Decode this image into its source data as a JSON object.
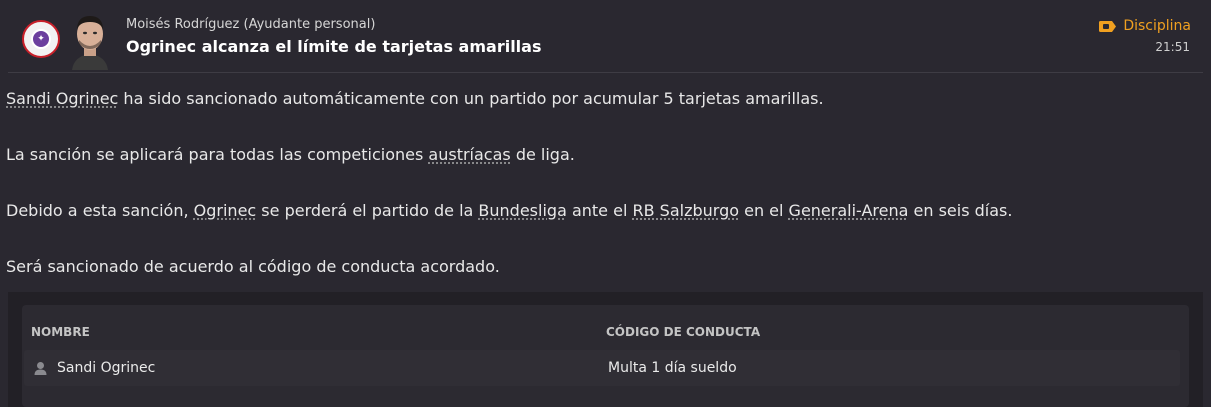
{
  "header": {
    "sender": "Moisés Rodríguez  (Ayudante personal)",
    "subject": "Ogrinec alcanza el límite de tarjetas amarillas",
    "category": "Disciplina",
    "category_icon": "yellow-card-tag-icon",
    "time": "21:51",
    "accent_color": "#f0a020"
  },
  "body": {
    "p1": {
      "player": "Sandi Ogrinec",
      "rest": " ha sido sancionado automáticamente con un partido por acumular 5 tarjetas amarillas."
    },
    "p2": {
      "before": "La sanción se aplicará para todas las competiciones ",
      "link": "austríacas",
      "after": " de liga."
    },
    "p3": {
      "t1": "Debido a esta sanción, ",
      "player": "Ogrinec",
      "t2": " se perderá el partido de la ",
      "competition": "Bundesliga",
      "t3": " ante el ",
      "opponent": "RB Salzburgo",
      "t4": " en el ",
      "stadium": "Generali-Arena",
      "t5": " en seis días."
    },
    "p4": "Será sancionado de acuerdo al código de conducta acordado."
  },
  "table": {
    "columns": [
      "NOMBRE",
      "CÓDIGO DE CONDUCTA"
    ],
    "rows": [
      {
        "name": "Sandi Ogrinec",
        "conduct": "Multa 1 día sueldo",
        "icon": "person-icon"
      }
    ]
  }
}
